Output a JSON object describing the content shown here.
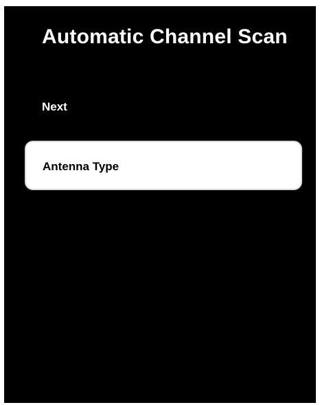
{
  "screen": {
    "title": "Automatic Channel Scan",
    "next_label": "Next",
    "menu_items": [
      {
        "label": "Antenna Type",
        "selected": true
      }
    ]
  },
  "colors": {
    "background": "#000000",
    "text": "#ffffff",
    "selected_item_background": "#ffffff",
    "selected_item_text": "#000000"
  }
}
